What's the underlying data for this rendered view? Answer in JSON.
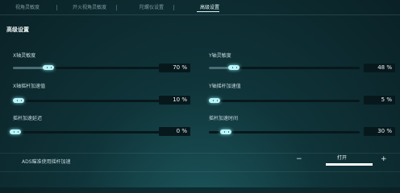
{
  "tabs": [
    {
      "label": "视角灵敏度"
    },
    {
      "label": "开火视角灵敏度"
    },
    {
      "label": "陀螺仪设置"
    },
    {
      "label": "高级设置"
    }
  ],
  "section_title": "高级设置",
  "sliders": [
    {
      "label": "X轴灵敏度",
      "value_text": "70 %",
      "value_fraction": 0.25
    },
    {
      "label": "Y轴灵敏度",
      "value_text": "48 %",
      "value_fraction": 0.17
    },
    {
      "label": "X轴摇杆加速值",
      "value_text": "10 %",
      "value_fraction": 0.0
    },
    {
      "label": "Y轴摇杆加速值",
      "value_text": "5 %",
      "value_fraction": 0.0
    },
    {
      "label": "摇杆加速延迟",
      "value_text": "0 %",
      "value_fraction": 0.0
    },
    {
      "label": "摇杆加速时间",
      "value_text": "30 %",
      "value_fraction": 0.0
    }
  ],
  "ads_option": {
    "label": "ADS瞄准使用摇杆加速",
    "minus": "−",
    "plus": "+",
    "state": "打开",
    "level_fraction": 1.0
  }
}
